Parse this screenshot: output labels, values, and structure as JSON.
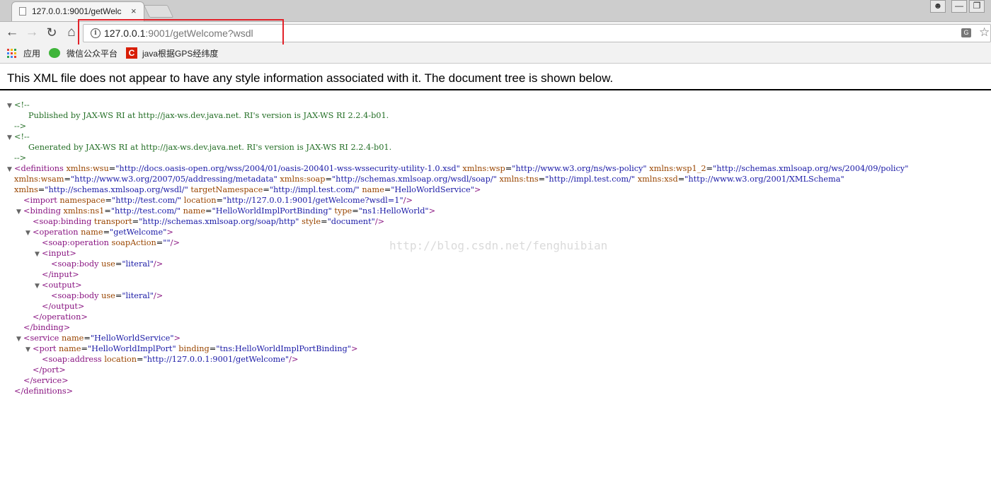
{
  "browser": {
    "tab_title": "127.0.0.1:9001/getWelc",
    "tab_close": "×",
    "url_host": "127.0.0.1",
    "url_rest": ":9001/getWelcome?wsdl"
  },
  "bookmarks": {
    "apps": "应用",
    "wechat": "微信公众平台",
    "java": "java根据GPS经纬度"
  },
  "page": {
    "header": "This XML file does not appear to have any style information associated with it. The document tree is shown below."
  },
  "xml_lines": [
    {
      "indent": 0,
      "arrow": "▼",
      "tokens": [
        {
          "c": "cm",
          "t": "<!--"
        }
      ]
    },
    {
      "indent": 20,
      "arrow": "",
      "tokens": [
        {
          "c": "cm",
          "t": "Published by JAX-WS RI at http://jax-ws.dev.java.net. RI's version is JAX-WS RI 2.2.4-b01."
        }
      ]
    },
    {
      "indent": 0,
      "arrow": "",
      "tokens": [
        {
          "c": "cm",
          "t": "-->"
        }
      ]
    },
    {
      "indent": 0,
      "arrow": "▼",
      "tokens": [
        {
          "c": "cm",
          "t": "<!--"
        }
      ]
    },
    {
      "indent": 20,
      "arrow": "",
      "tokens": [
        {
          "c": "cm",
          "t": "Generated by JAX-WS RI at http://jax-ws.dev.java.net. RI's version is JAX-WS RI 2.2.4-b01."
        }
      ]
    },
    {
      "indent": 0,
      "arrow": "",
      "tokens": [
        {
          "c": "cm",
          "t": "-->"
        }
      ]
    },
    {
      "indent": 0,
      "arrow": "▼",
      "tokens": [
        {
          "c": "tg",
          "t": "<definitions "
        },
        {
          "c": "an",
          "t": "xmlns:wsu"
        },
        {
          "c": "pl",
          "t": "="
        },
        {
          "c": "av",
          "t": "\"http://docs.oasis-open.org/wss/2004/01/oasis-200401-wss-wssecurity-utility-1.0.xsd\""
        },
        {
          "c": "an",
          "t": " xmlns:wsp"
        },
        {
          "c": "pl",
          "t": "="
        },
        {
          "c": "av",
          "t": "\"http://www.w3.org/ns/ws-policy\""
        },
        {
          "c": "an",
          "t": " xmlns:wsp1_2"
        },
        {
          "c": "pl",
          "t": "="
        },
        {
          "c": "av",
          "t": "\"http://schemas.xmlsoap.org/ws/2004/09/policy\""
        }
      ]
    },
    {
      "indent": 0,
      "arrow": "",
      "tokens": [
        {
          "c": "an",
          "t": "xmlns:wsam"
        },
        {
          "c": "pl",
          "t": "="
        },
        {
          "c": "av",
          "t": "\"http://www.w3.org/2007/05/addressing/metadata\""
        },
        {
          "c": "an",
          "t": " xmlns:soap"
        },
        {
          "c": "pl",
          "t": "="
        },
        {
          "c": "av",
          "t": "\"http://schemas.xmlsoap.org/wsdl/soap/\""
        },
        {
          "c": "an",
          "t": " xmlns:tns"
        },
        {
          "c": "pl",
          "t": "="
        },
        {
          "c": "av",
          "t": "\"http://impl.test.com/\""
        },
        {
          "c": "an",
          "t": " xmlns:xsd"
        },
        {
          "c": "pl",
          "t": "="
        },
        {
          "c": "av",
          "t": "\"http://www.w3.org/2001/XMLSchema\""
        }
      ]
    },
    {
      "indent": 0,
      "arrow": "",
      "tokens": [
        {
          "c": "an",
          "t": "xmlns"
        },
        {
          "c": "pl",
          "t": "="
        },
        {
          "c": "av",
          "t": "\"http://schemas.xmlsoap.org/wsdl/\""
        },
        {
          "c": "an",
          "t": " targetNamespace"
        },
        {
          "c": "pl",
          "t": "="
        },
        {
          "c": "av",
          "t": "\"http://impl.test.com/\""
        },
        {
          "c": "an",
          "t": " name"
        },
        {
          "c": "pl",
          "t": "="
        },
        {
          "c": "av",
          "t": "\"HelloWorldService\""
        },
        {
          "c": "tg",
          "t": ">"
        }
      ]
    },
    {
      "indent": 13,
      "arrow": "",
      "tokens": [
        {
          "c": "tg",
          "t": "<import "
        },
        {
          "c": "an",
          "t": "namespace"
        },
        {
          "c": "pl",
          "t": "="
        },
        {
          "c": "av",
          "t": "\"http://test.com/\""
        },
        {
          "c": "an",
          "t": " location"
        },
        {
          "c": "pl",
          "t": "="
        },
        {
          "c": "av",
          "t": "\"http://127.0.0.1:9001/getWelcome?wsdl=1\""
        },
        {
          "c": "tg",
          "t": "/>"
        }
      ]
    },
    {
      "indent": 13,
      "arrow": "▼",
      "tokens": [
        {
          "c": "tg",
          "t": "<binding "
        },
        {
          "c": "an",
          "t": "xmlns:ns1"
        },
        {
          "c": "pl",
          "t": "="
        },
        {
          "c": "av",
          "t": "\"http://test.com/\""
        },
        {
          "c": "an",
          "t": " name"
        },
        {
          "c": "pl",
          "t": "="
        },
        {
          "c": "av",
          "t": "\"HelloWorldImplPortBinding\""
        },
        {
          "c": "an",
          "t": " type"
        },
        {
          "c": "pl",
          "t": "="
        },
        {
          "c": "av",
          "t": "\"ns1:HelloWorld\""
        },
        {
          "c": "tg",
          "t": ">"
        }
      ]
    },
    {
      "indent": 26,
      "arrow": "",
      "tokens": [
        {
          "c": "tg",
          "t": "<soap:binding "
        },
        {
          "c": "an",
          "t": "transport"
        },
        {
          "c": "pl",
          "t": "="
        },
        {
          "c": "av",
          "t": "\"http://schemas.xmlsoap.org/soap/http\""
        },
        {
          "c": "an",
          "t": " style"
        },
        {
          "c": "pl",
          "t": "="
        },
        {
          "c": "av",
          "t": "\"document\""
        },
        {
          "c": "tg",
          "t": "/>"
        }
      ]
    },
    {
      "indent": 26,
      "arrow": "▼",
      "tokens": [
        {
          "c": "tg",
          "t": "<operation "
        },
        {
          "c": "an",
          "t": "name"
        },
        {
          "c": "pl",
          "t": "="
        },
        {
          "c": "av",
          "t": "\"getWelcome\""
        },
        {
          "c": "tg",
          "t": ">"
        }
      ]
    },
    {
      "indent": 39,
      "arrow": "",
      "tokens": [
        {
          "c": "tg",
          "t": "<soap:operation "
        },
        {
          "c": "an",
          "t": "soapAction"
        },
        {
          "c": "pl",
          "t": "="
        },
        {
          "c": "av",
          "t": "\"\""
        },
        {
          "c": "tg",
          "t": "/>"
        }
      ]
    },
    {
      "indent": 39,
      "arrow": "▼",
      "tokens": [
        {
          "c": "tg",
          "t": "<input>"
        }
      ]
    },
    {
      "indent": 52,
      "arrow": "",
      "tokens": [
        {
          "c": "tg",
          "t": "<soap:body "
        },
        {
          "c": "an",
          "t": "use"
        },
        {
          "c": "pl",
          "t": "="
        },
        {
          "c": "av",
          "t": "\"literal\""
        },
        {
          "c": "tg",
          "t": "/>"
        }
      ]
    },
    {
      "indent": 39,
      "arrow": "",
      "tokens": [
        {
          "c": "tg",
          "t": "</input>"
        }
      ]
    },
    {
      "indent": 39,
      "arrow": "▼",
      "tokens": [
        {
          "c": "tg",
          "t": "<output>"
        }
      ]
    },
    {
      "indent": 52,
      "arrow": "",
      "tokens": [
        {
          "c": "tg",
          "t": "<soap:body "
        },
        {
          "c": "an",
          "t": "use"
        },
        {
          "c": "pl",
          "t": "="
        },
        {
          "c": "av",
          "t": "\"literal\""
        },
        {
          "c": "tg",
          "t": "/>"
        }
      ]
    },
    {
      "indent": 39,
      "arrow": "",
      "tokens": [
        {
          "c": "tg",
          "t": "</output>"
        }
      ]
    },
    {
      "indent": 26,
      "arrow": "",
      "tokens": [
        {
          "c": "tg",
          "t": "</operation>"
        }
      ]
    },
    {
      "indent": 13,
      "arrow": "",
      "tokens": [
        {
          "c": "tg",
          "t": "</binding>"
        }
      ]
    },
    {
      "indent": 13,
      "arrow": "▼",
      "tokens": [
        {
          "c": "tg",
          "t": "<service "
        },
        {
          "c": "an",
          "t": "name"
        },
        {
          "c": "pl",
          "t": "="
        },
        {
          "c": "av",
          "t": "\"HelloWorldService\""
        },
        {
          "c": "tg",
          "t": ">"
        }
      ]
    },
    {
      "indent": 26,
      "arrow": "▼",
      "tokens": [
        {
          "c": "tg",
          "t": "<port "
        },
        {
          "c": "an",
          "t": "name"
        },
        {
          "c": "pl",
          "t": "="
        },
        {
          "c": "av",
          "t": "\"HelloWorldImplPort\""
        },
        {
          "c": "an",
          "t": " binding"
        },
        {
          "c": "pl",
          "t": "="
        },
        {
          "c": "av",
          "t": "\"tns:HelloWorldImplPortBinding\""
        },
        {
          "c": "tg",
          "t": ">"
        }
      ]
    },
    {
      "indent": 39,
      "arrow": "",
      "tokens": [
        {
          "c": "tg",
          "t": "<soap:address "
        },
        {
          "c": "an",
          "t": "location"
        },
        {
          "c": "pl",
          "t": "="
        },
        {
          "c": "av",
          "t": "\"http://127.0.0.1:9001/getWelcome\""
        },
        {
          "c": "tg",
          "t": "/>"
        }
      ]
    },
    {
      "indent": 26,
      "arrow": "",
      "tokens": [
        {
          "c": "tg",
          "t": "</port>"
        }
      ]
    },
    {
      "indent": 13,
      "arrow": "",
      "tokens": [
        {
          "c": "tg",
          "t": "</service>"
        }
      ]
    },
    {
      "indent": 0,
      "arrow": "",
      "tokens": [
        {
          "c": "tg",
          "t": "</definitions>"
        }
      ]
    }
  ],
  "watermark": "http://blog.csdn.net/fenghuibian",
  "icons": {
    "back": "←",
    "forward": "→",
    "reload": "↻",
    "home": "⌂",
    "star": "☆",
    "info": "i",
    "translate": "G"
  },
  "colors": {
    "highlight": "#e2222a",
    "tag": "#881280",
    "attr_name": "#994500",
    "attr_value": "#1a1aa6",
    "comment": "#236e25"
  }
}
